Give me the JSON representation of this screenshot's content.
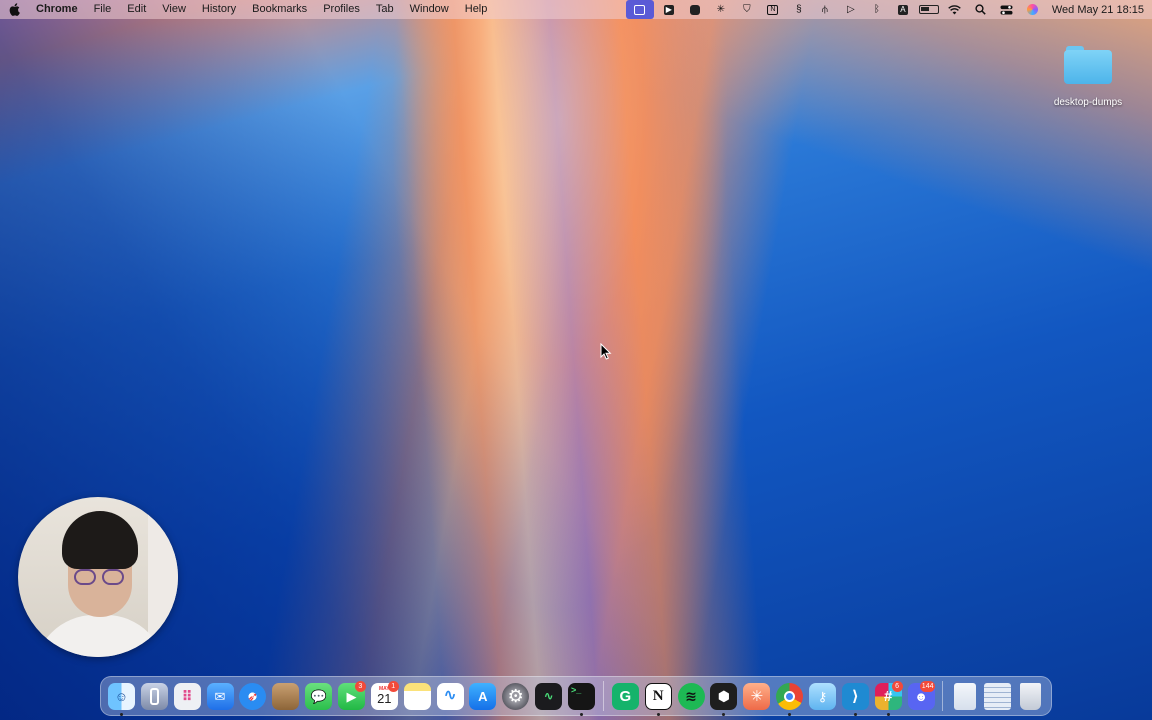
{
  "menubar": {
    "app_name": "Chrome",
    "menus": [
      "File",
      "Edit",
      "View",
      "History",
      "Bookmarks",
      "Profiles",
      "Tab",
      "Window",
      "Help"
    ],
    "status_icons": [
      "screen-record-icon",
      "media-icon",
      "camera-icon",
      "perplexity-icon",
      "brave-icon",
      "notion-icon",
      "grammarly-icon",
      "split-icon",
      "play-icon",
      "bluetooth-icon",
      "keyboard-input-icon",
      "battery-icon",
      "wifi-icon",
      "spotlight-icon",
      "control-center-icon",
      "siri-icon"
    ],
    "input_letter": "A",
    "clock": "Wed May 21  18:15"
  },
  "desktop": {
    "folder_label": "desktop-dumps"
  },
  "dock": {
    "calendar_month": "MAY",
    "calendar_day": "21",
    "messages_badge": "3",
    "calendar_badge": "1",
    "slack_badge": "6",
    "discord_badge": "144",
    "items": [
      {
        "name": "finder",
        "color": "#3a8ef0"
      },
      {
        "name": "mirroring",
        "color": "#5a6a8a"
      },
      {
        "name": "launchpad",
        "color": "#e8e8ec"
      },
      {
        "name": "mail",
        "color": "#3d8ff5"
      },
      {
        "name": "safari",
        "color": "#1e88f0"
      },
      {
        "name": "brown-app",
        "color": "#b58a5a"
      },
      {
        "name": "messages",
        "color": "#34c759"
      },
      {
        "name": "facetime",
        "color": "#2ecc55"
      },
      {
        "name": "calendar",
        "color": "#ffffff"
      },
      {
        "name": "notes",
        "color": "#f6d35a"
      },
      {
        "name": "freeform",
        "color": "#ffffff"
      },
      {
        "name": "app-store",
        "color": "#1a8cf0"
      },
      {
        "name": "system-settings",
        "color": "#8a8a90"
      },
      {
        "name": "activity-monitor",
        "color": "#222222"
      },
      {
        "name": "terminal",
        "color": "#111111"
      },
      {
        "name": "grammarly",
        "color": "#15b36b"
      },
      {
        "name": "notion",
        "color": "#ffffff"
      },
      {
        "name": "spotify",
        "color": "#1db954"
      },
      {
        "name": "cursor",
        "color": "#202020"
      },
      {
        "name": "perplexity",
        "color": "#f2765a"
      },
      {
        "name": "chrome",
        "color": "#ffffff"
      },
      {
        "name": "keychain",
        "color": "#7fc7ff"
      },
      {
        "name": "vscode",
        "color": "#1f8ad2"
      },
      {
        "name": "slack",
        "color": "#ffffff"
      },
      {
        "name": "discord",
        "color": "#5865f2"
      },
      {
        "name": "documents",
        "color": "#e9eef6"
      },
      {
        "name": "downloads",
        "color": "#dfe7f3"
      },
      {
        "name": "trash",
        "color": "#d8dde6"
      }
    ]
  }
}
